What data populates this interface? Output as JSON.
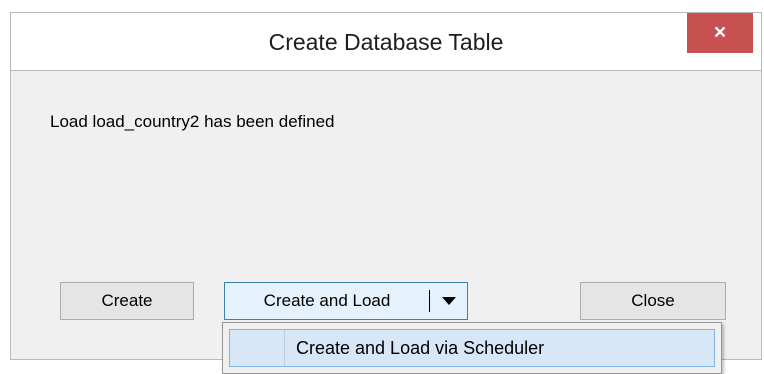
{
  "dialog": {
    "title": "Create Database Table",
    "close_glyph": "×",
    "message": "Load load_country2 has been defined"
  },
  "buttons": {
    "create_label": "Create",
    "create_and_load_label": "Create and Load",
    "close_label": "Close"
  },
  "dropdown_menu": {
    "items": [
      {
        "label": "Create and Load via Scheduler",
        "highlighted": true
      }
    ]
  },
  "colors": {
    "close_button_red": "#c75050",
    "highlight_blue": "#d7e7f8",
    "dialog_background": "#f0f0f0"
  }
}
